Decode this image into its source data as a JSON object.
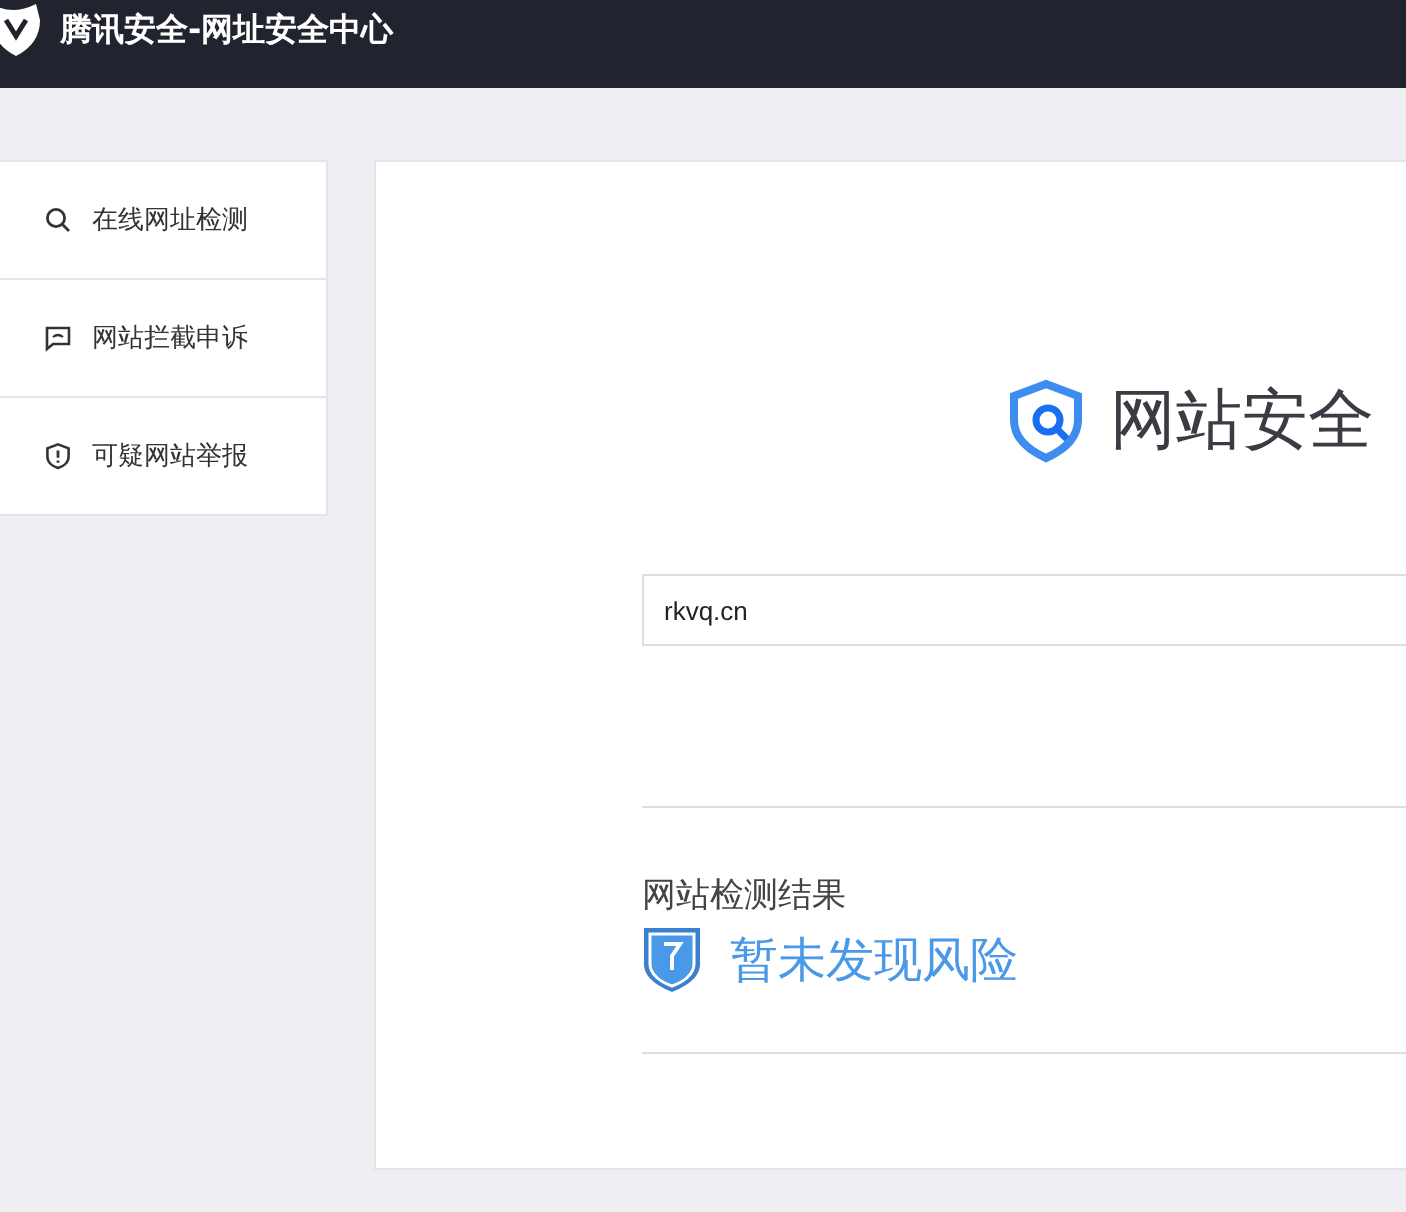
{
  "header": {
    "title": "腾讯安全-网址安全中心"
  },
  "sidebar": {
    "items": [
      {
        "kind": "search",
        "label": "在线网址检测"
      },
      {
        "kind": "chat",
        "label": "网站拦截申诉"
      },
      {
        "kind": "shield",
        "label": "可疑网站举报"
      }
    ]
  },
  "main": {
    "title": "网站安全",
    "search": {
      "value": "rkvq.cn"
    },
    "result": {
      "label": "网站检测结果",
      "status": "暂未发现风险"
    }
  }
}
